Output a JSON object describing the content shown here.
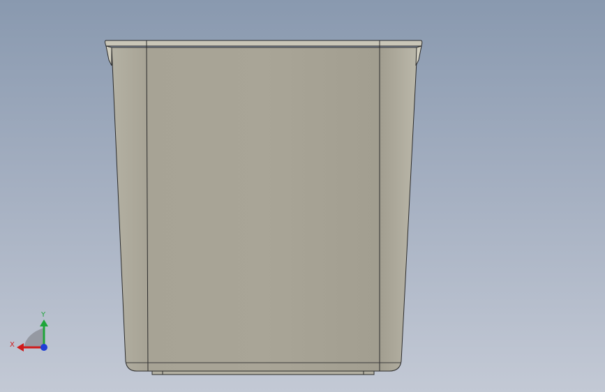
{
  "viewport": {
    "background_top": "#8999af",
    "background_bottom": "#c3c9d5"
  },
  "model": {
    "body_color": "#a8a497",
    "edge_color": "#2b2b2b",
    "rim_color": "#c9c6b8"
  },
  "triad": {
    "x_label": "X",
    "y_label": "Y",
    "x_color": "#d01a1a",
    "y_color": "#1fa53a",
    "z_color": "#1f3fd6"
  }
}
